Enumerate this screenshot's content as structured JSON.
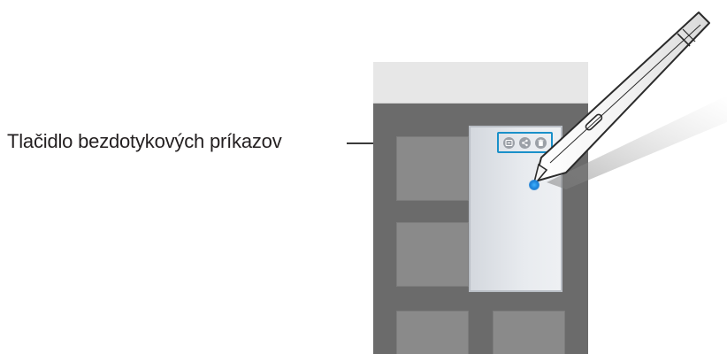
{
  "callout": {
    "label": "Tlačidlo bezdotykových príkazov"
  },
  "note_window": {
    "toolbar_icons": [
      "collapse-icon",
      "share-icon",
      "delete-icon"
    ]
  },
  "colors": {
    "highlight": "#1a90c9",
    "screen_bg": "#6b6b6b",
    "note_bg": "#e8ebef",
    "pen_tip": "#1a7fd6"
  }
}
